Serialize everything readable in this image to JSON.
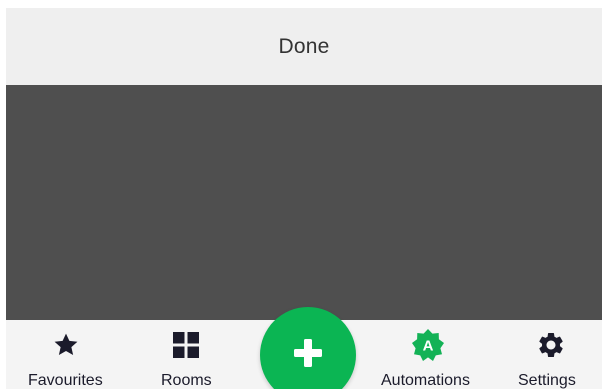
{
  "header": {
    "done_label": "Done"
  },
  "bottom_nav": {
    "items": [
      {
        "label": "Favourites",
        "icon": "star-icon",
        "active": false
      },
      {
        "label": "Rooms",
        "icon": "grid-icon",
        "active": false
      },
      {
        "label": "Automations",
        "icon": "automation-badge-icon",
        "badge_letter": "A",
        "active": true
      },
      {
        "label": "Settings",
        "icon": "gear-icon",
        "active": false
      }
    ],
    "add_button_icon": "plus-icon"
  },
  "colors": {
    "header_bg": "#efefef",
    "content_bg": "#4f4f4f",
    "nav_bg": "#f4f4f4",
    "accent_green": "#13b256",
    "fab_green": "#0bb553",
    "icon_dark": "#1b1b2b"
  }
}
